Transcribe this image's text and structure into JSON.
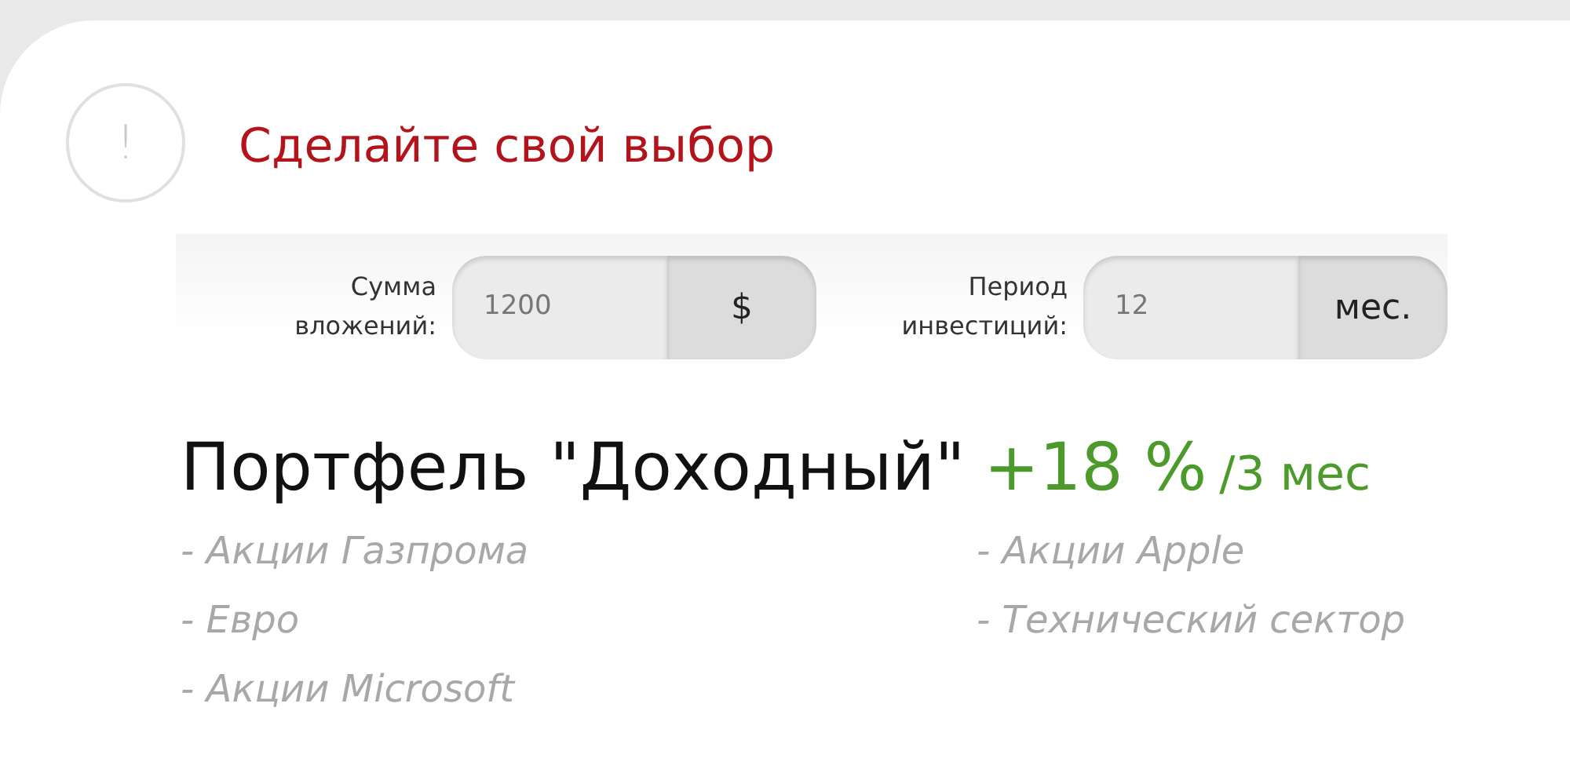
{
  "alert": {
    "symbol": "!",
    "title": "Сделайте свой выбор"
  },
  "fields": [
    {
      "label": "Сумма вложений:",
      "value": "1200",
      "unit": "$"
    },
    {
      "label": "Период инвестиций:",
      "value": "12",
      "unit": "мес."
    }
  ],
  "portfolio": {
    "name": "Портфель \"Доходный\"",
    "return": "+18 %",
    "period": "/3 мес"
  },
  "holdings": [
    "- Акции Газпрома",
    "- Акции Apple",
    "- Евро",
    "- Технический сектор",
    "- Акции Microsoft"
  ]
}
